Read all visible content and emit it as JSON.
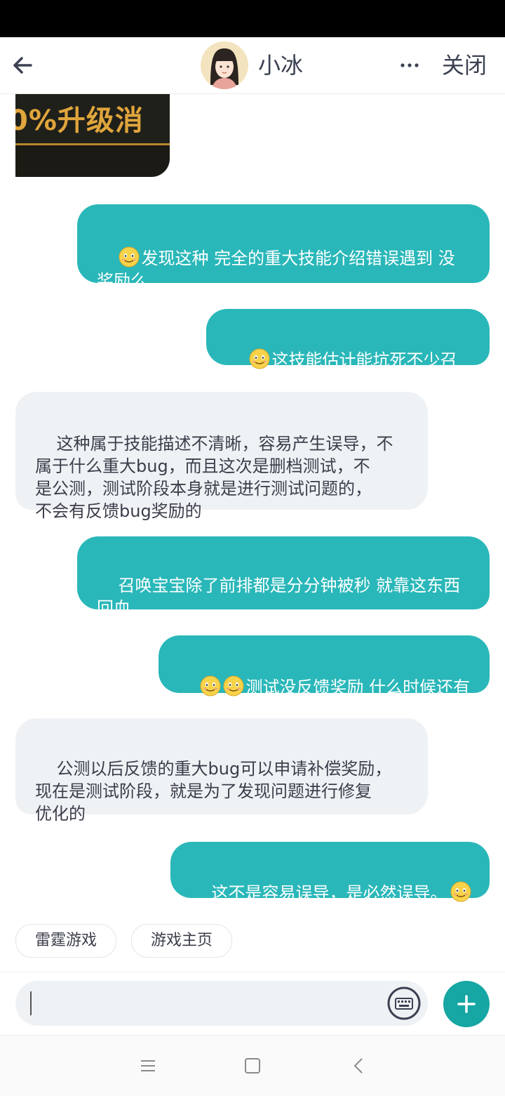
{
  "header": {
    "title": "小冰",
    "close_label": "关闭"
  },
  "chat": {
    "image_text": "0%升级消",
    "messages": [
      {
        "side": "right",
        "emoji": 1,
        "text": "发现这种 完全的重大技能介绍错误遇到 没\n奖励么"
      },
      {
        "side": "right",
        "emoji": 1,
        "text": "这技能估计能坑死不少召唤"
      },
      {
        "side": "left",
        "text": "这种属于技能描述不清晰，容易产生误导，不\n属于什么重大bug，而且这次是删档测试，不\n是公测，测试阶段本身就是进行测试问题的，\n不会有反馈bug奖励的"
      },
      {
        "side": "right",
        "text": "召唤宝宝除了前排都是分分钟被秒 就靠这东西\n回血"
      },
      {
        "side": "right",
        "emoji": 2,
        "text": "测试没反馈奖励 什么时候还有"
      },
      {
        "side": "left",
        "text": "公测以后反馈的重大bug可以申请补偿奖励，\n现在是测试阶段，就是为了发现问题进行修复\n优化的"
      },
      {
        "side": "right",
        "emoji_end": 1,
        "text": "这不是容易误导，是必然误导。"
      }
    ]
  },
  "quick_replies": [
    "雷霆游戏",
    "游戏主页"
  ],
  "composer": {
    "placeholder": ""
  },
  "colors": {
    "accent": "#2ab7b9",
    "incoming_bubble": "#eff2f5",
    "send_button": "#16a6a3"
  },
  "icons": [
    "back-arrow-icon",
    "more-icon",
    "keyboard-icon",
    "plus-icon",
    "menu-icon",
    "home-square-icon",
    "back-chevron-icon",
    "smile-emoji-icon"
  ]
}
